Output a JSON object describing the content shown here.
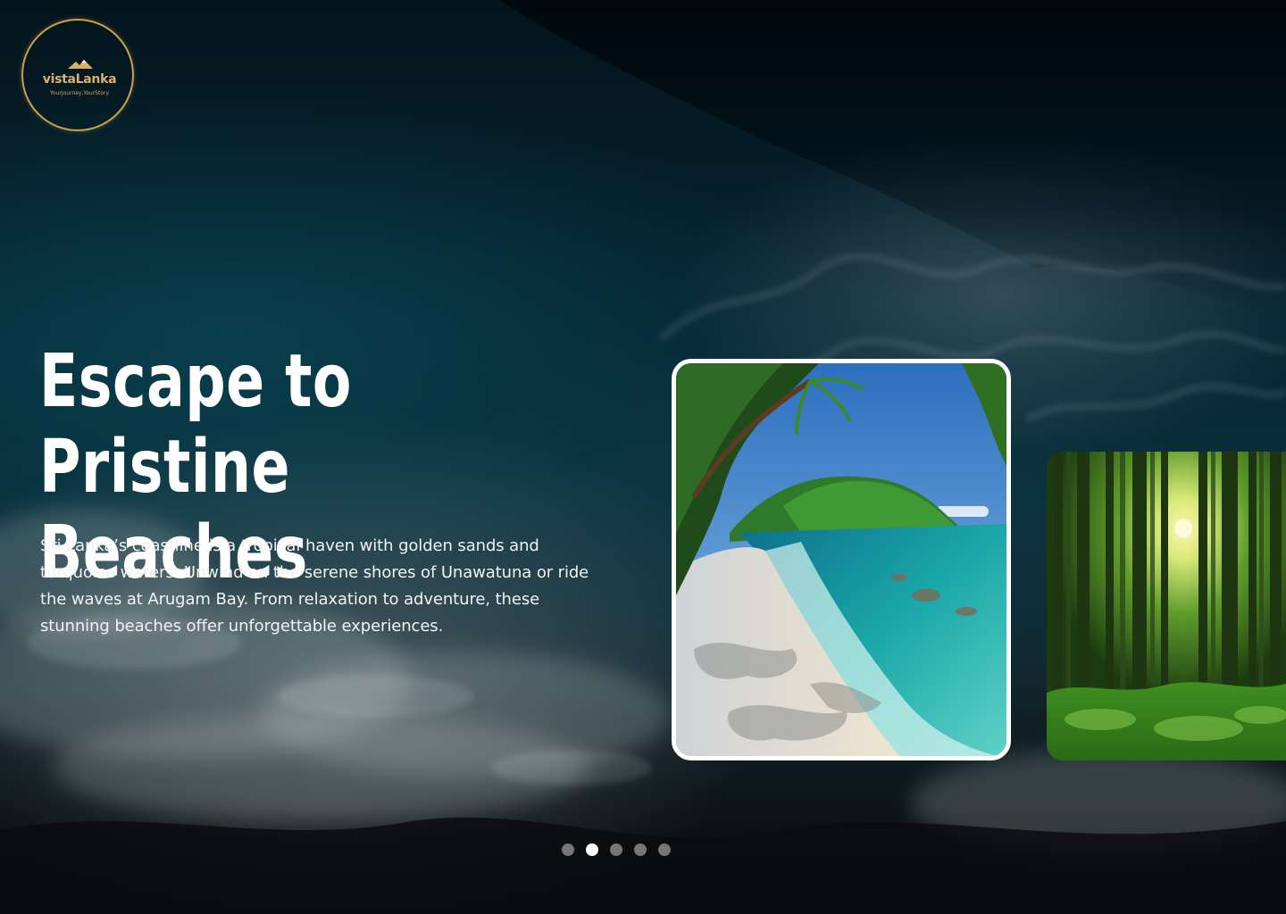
{
  "brand": {
    "name": "vistaLanka",
    "tagline": "YourJourney,YourStory",
    "accent": "#c9a04e"
  },
  "hero": {
    "title_line1": "Escape to Pristine",
    "title_line2": "Beaches",
    "description": "Sri Lanka’s coastline is a tropical haven with golden sands and turquoise waters. Unwind on the serene shores of Unawatuna or ride the waves at Arugam Bay. From relaxation to adventure, these stunning beaches offer unforgettable experiences."
  },
  "carousel": {
    "cards": [
      {
        "name": "beach-card",
        "icon": "tropical-beach-image",
        "active": true
      },
      {
        "name": "forest-card",
        "icon": "forest-image",
        "active": false
      }
    ],
    "pagination": {
      "count": 5,
      "active_index": 1
    }
  },
  "colors": {
    "dot_active": "#ffffff",
    "dot_inactive": "#8a8a8a",
    "text": "#ffffff"
  }
}
